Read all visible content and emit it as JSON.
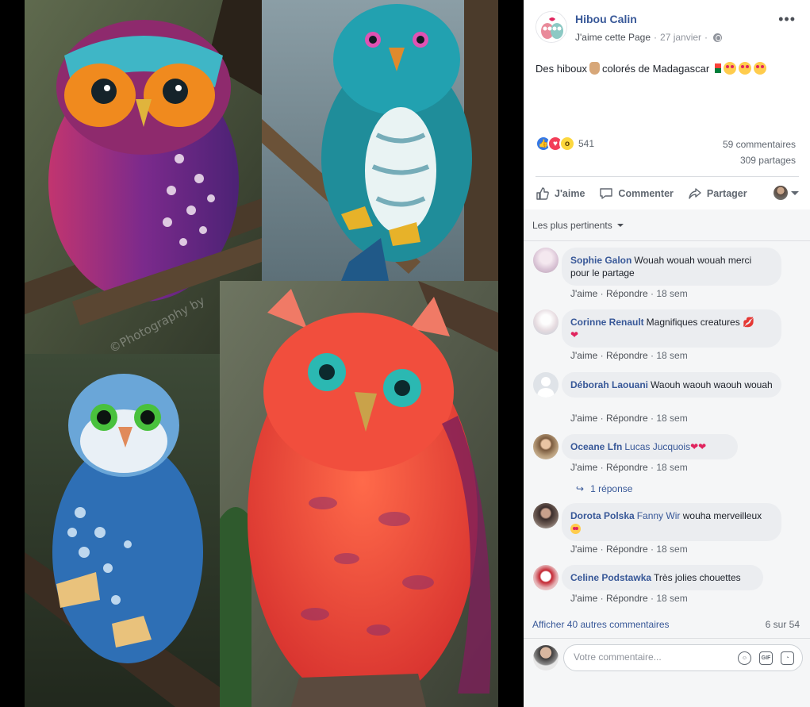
{
  "post": {
    "page_name": "Hibou Calin",
    "like_page": "J'aime cette Page",
    "separator": " · ",
    "date": "27 janvier",
    "privacy_sep": " · ",
    "text": "Des hiboux",
    "text_2": "colorés de Madagascar",
    "reaction_count": "541",
    "comments_count": "59 commentaires",
    "shares_count": "309 partages",
    "photo_watermark": "©Photography by"
  },
  "actions": {
    "like": "J'aime",
    "comment": "Commenter",
    "share": "Partager"
  },
  "comments": {
    "sort_label": "Les plus pertinents",
    "items": [
      {
        "author": "Sophie Galon",
        "text": "Wouah wouah wouah merci pour le partage",
        "like": "J'aime",
        "reply": "Répondre",
        "time": "18 sem"
      },
      {
        "author": "Corinne Renault",
        "text": "Magnifiques creatures",
        "like": "J'aime",
        "reply": "Répondre",
        "time": "18 sem"
      },
      {
        "author": "Déborah Laouani",
        "text": "Waouh waouh waouh wouah",
        "like": "J'aime",
        "reply": "Répondre",
        "time": "18 sem"
      },
      {
        "author": "Oceane Lfn",
        "tag": "Lucas Jucquois",
        "text": "",
        "like": "J'aime",
        "reply": "Répondre",
        "time": "18 sem"
      },
      {
        "author": "Dorota Polska",
        "tag": "Fanny Wir",
        "text": "wouha merveilleux",
        "like": "J'aime",
        "reply": "Répondre",
        "time": "18 sem"
      },
      {
        "author": "Celine Podstawka",
        "text": "Très jolies chouettes",
        "like": "J'aime",
        "reply": "Répondre",
        "time": "18 sem"
      }
    ],
    "replies_label": "1 réponse",
    "show_more": "Afficher 40 autres commentaires",
    "pager": "6 sur 54",
    "compose_placeholder": "Votre commentaire..."
  },
  "colors": {
    "link": "#385898",
    "bubble": "#ebedf0",
    "panel": "#f5f6f7"
  }
}
